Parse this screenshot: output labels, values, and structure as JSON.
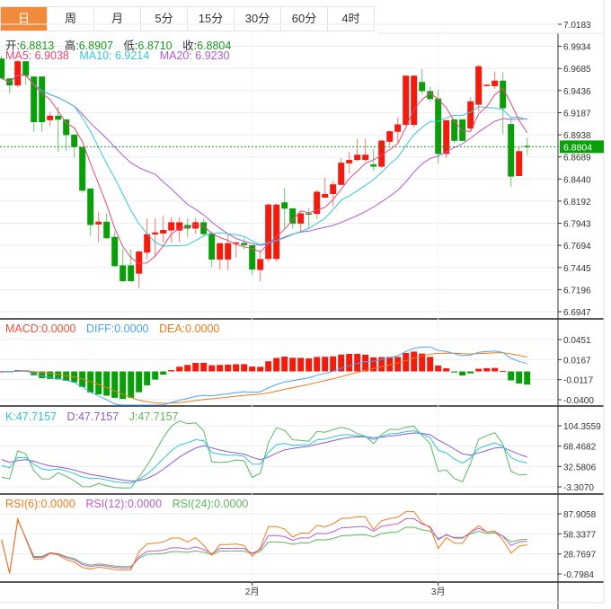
{
  "tabs": [
    {
      "label": "日",
      "active": true
    },
    {
      "label": "周"
    },
    {
      "label": "月"
    },
    {
      "label": "5分"
    },
    {
      "label": "15分"
    },
    {
      "label": "30分"
    },
    {
      "label": "60分"
    },
    {
      "label": "4时"
    }
  ],
  "quote": {
    "open_label": "开:",
    "open": "6.8813",
    "high_label": "高:",
    "high": "6.8907",
    "low_label": "低:",
    "low": "6.8710",
    "close_label": "收:",
    "close": "6.8804"
  },
  "ma_legend": {
    "ma5": "MA5: 6.9038",
    "ma10": "MA10: 6.9214",
    "ma20": "MA20: 6.9230"
  },
  "macd_legend": {
    "macd": "MACD:0.0000",
    "diff": "DIFF:0.0000",
    "dea": "DEA:0.0000"
  },
  "kdj_legend": {
    "k": "K:47.7157",
    "d": "D:47.7157",
    "j": "J:47.7157"
  },
  "rsi_legend": {
    "rsi6": "RSI(6):0.0000",
    "rsi12": "RSI(12):0.0000",
    "rsi24": "RSI(24):0.0000"
  },
  "current_price": "6.8804",
  "colors": {
    "up": "#f41a0c",
    "down": "#0a9e0a",
    "ma5": "#e8487a",
    "ma10": "#36c6dc",
    "ma20": "#b05ad0",
    "diff": "#4aa3f0",
    "dea": "#f07c1e",
    "k": "#2ec3d6",
    "d": "#8a5ad0",
    "j": "#5cb85c",
    "rsi6": "#f07c1e",
    "rsi12": "#c05ad0",
    "rsi24": "#5cb85c",
    "accent": "#f28a3c"
  },
  "chart_data": {
    "type": "candlestick",
    "price_ticks": [
      "7.0183",
      "6.9934",
      "6.9685",
      "6.9436",
      "6.9187",
      "6.8938",
      "6.8689",
      "6.8440",
      "6.8192",
      "6.7943",
      "6.7694",
      "6.7445",
      "6.7196",
      "6.6947"
    ],
    "price_range": [
      6.6947,
      7.0183
    ],
    "macd_ticks": [
      "0.0451",
      "0.0167",
      "-0.0117",
      "-0.0400"
    ],
    "macd_range": [
      -0.04,
      0.0451
    ],
    "kdj_ticks": [
      "104.3559",
      "68.4682",
      "32.5806",
      "-3.3070"
    ],
    "kdj_range": [
      -3.307,
      104.3559
    ],
    "rsi_ticks": [
      "87.9058",
      "58.3377",
      "28.7697",
      "-0.7984"
    ],
    "rsi_range": [
      -0.7984,
      87.9058
    ],
    "x_labels": [
      {
        "label": "2月",
        "index": 31
      },
      {
        "label": "3月",
        "index": 54
      }
    ],
    "ohlc": [
      [
        6.9797,
        6.9828,
        6.9564,
        6.9573
      ],
      [
        6.9573,
        6.9573,
        6.9402,
        6.9495
      ],
      [
        6.9495,
        6.9782,
        6.947,
        6.9766
      ],
      [
        6.9766,
        6.9766,
        6.9501,
        6.9601
      ],
      [
        6.9595,
        6.9595,
        6.8972,
        6.9081
      ],
      [
        6.9595,
        6.9595,
        6.8972,
        6.9081
      ],
      [
        6.9103,
        6.9196,
        6.9034,
        6.9153
      ],
      [
        6.9153,
        6.9252,
        6.8748,
        6.9109
      ],
      [
        6.9112,
        6.9112,
        6.8754,
        6.8935
      ],
      [
        6.8941,
        6.8941,
        6.8683,
        6.8801
      ],
      [
        6.8801,
        6.8801,
        6.8287,
        6.8309
      ],
      [
        6.8334,
        6.8334,
        6.7799,
        6.7923
      ],
      [
        6.7929,
        6.8076,
        6.7727,
        6.796
      ],
      [
        6.796,
        6.8054,
        6.7764,
        6.7774
      ],
      [
        6.7789,
        6.7852,
        6.7453,
        6.7459
      ],
      [
        6.7469,
        6.7649,
        6.7282,
        6.7291
      ],
      [
        6.7469,
        6.7649,
        6.7282,
        6.7291
      ],
      [
        6.7375,
        6.7634,
        6.7213,
        6.7624
      ],
      [
        6.7612,
        6.7998,
        6.754,
        6.782
      ],
      [
        6.7817,
        6.7998,
        6.7571,
        6.7839
      ],
      [
        6.7827,
        6.8029,
        6.7727,
        6.7867
      ],
      [
        6.7861,
        6.8013,
        6.7727,
        6.7954
      ],
      [
        6.7861,
        6.8013,
        6.7727,
        6.7954
      ],
      [
        6.7923,
        6.7998,
        6.7789,
        6.7883
      ],
      [
        6.7883,
        6.7998,
        6.782,
        6.7954
      ],
      [
        6.7954,
        6.7992,
        6.7805,
        6.782
      ],
      [
        6.783,
        6.7852,
        6.7447,
        6.7534
      ],
      [
        6.7534,
        6.7718,
        6.7422,
        6.7718
      ],
      [
        6.7534,
        6.782,
        6.7416,
        6.7718
      ],
      [
        6.7711,
        6.7727,
        6.7556,
        6.7727
      ],
      [
        6.7721,
        6.7783,
        6.7649,
        6.7696
      ],
      [
        6.7696,
        6.7696,
        6.736,
        6.7422
      ],
      [
        6.7416,
        6.7634,
        6.7285,
        6.754
      ],
      [
        6.754,
        6.8163,
        6.7509,
        6.8153
      ],
      [
        6.754,
        6.8163,
        6.7509,
        6.8153
      ],
      [
        6.8178,
        6.8343,
        6.7883,
        6.8107
      ],
      [
        6.811,
        6.811,
        6.7883,
        6.7939
      ],
      [
        6.7939,
        6.8076,
        6.7858,
        6.8054
      ],
      [
        6.8054,
        6.8116,
        6.7883,
        6.8048
      ],
      [
        6.8048,
        6.8319,
        6.7992,
        6.8297
      ],
      [
        6.8231,
        6.8459,
        6.8231,
        6.8272
      ],
      [
        6.8272,
        6.8418,
        6.8132,
        6.8381
      ],
      [
        6.8375,
        6.8676,
        6.8375,
        6.8624
      ],
      [
        6.8617,
        6.8748,
        6.8505,
        6.8655
      ],
      [
        6.8655,
        6.8894,
        6.8636,
        6.8714
      ],
      [
        6.8655,
        6.8894,
        6.8636,
        6.8714
      ],
      [
        6.8605,
        6.8779,
        6.8536,
        6.858
      ],
      [
        6.858,
        6.8885,
        6.8561,
        6.8873
      ],
      [
        6.886,
        6.8988,
        6.8817,
        6.8978
      ],
      [
        6.8972,
        6.9128,
        6.8848,
        6.9056
      ],
      [
        6.905,
        6.961,
        6.9041,
        6.9604
      ],
      [
        6.905,
        6.961,
        6.9019,
        6.9604
      ],
      [
        6.9533,
        6.9682,
        6.9392,
        6.943
      ],
      [
        6.943,
        6.9477,
        6.9308,
        6.934
      ],
      [
        6.9346,
        6.9445,
        6.8614,
        6.8723
      ],
      [
        6.8723,
        6.9103,
        6.8676,
        6.9103
      ],
      [
        6.9112,
        6.9112,
        6.8848,
        6.887
      ],
      [
        6.9112,
        6.9112,
        6.8863,
        6.887
      ],
      [
        6.901,
        6.9361,
        6.8994,
        6.9315
      ],
      [
        6.9277,
        6.9729,
        6.9206,
        6.971
      ],
      [
        6.9486,
        6.9508,
        6.9486,
        6.9501
      ],
      [
        6.9486,
        6.9651,
        6.9455,
        6.9548
      ],
      [
        6.9548,
        6.9642,
        6.8947,
        6.9237
      ],
      [
        6.9059,
        6.9128,
        6.835,
        6.8468
      ],
      [
        6.8474,
        6.8801,
        6.8474,
        6.8754
      ],
      [
        6.8813,
        6.8907,
        6.871,
        6.8804
      ]
    ]
  }
}
